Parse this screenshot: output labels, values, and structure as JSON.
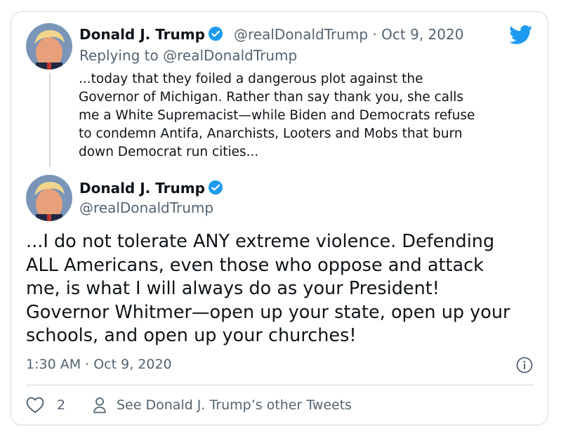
{
  "quoted_tweet": {
    "author_name": "Donald J. Trump",
    "handle": "@realDonaldTrump",
    "separator": "·",
    "date": "Oct 9, 2020",
    "replying_to": "Replying to @realDonaldTrump",
    "text": "...today that they foiled a dangerous plot against the\nGovernor of Michigan. Rather than say thank you, she calls\nme a White Supremacist—while Biden and Democrats refuse\nto condemn Antifa, Anarchists, Looters and Mobs that burn\ndown Democrat run cities..."
  },
  "main_tweet": {
    "author_name": "Donald J. Trump",
    "handle": "@realDonaldTrump",
    "text": "...I do not tolerate ANY extreme violence. Defending\nALL Americans, even those who oppose and attack\nme, is what I will always do as your President!\nGovernor Whitmer—open up your state, open up your\nschools, and open up your churches!",
    "timestamp": "1:30 AM · Oct 9, 2020"
  },
  "footer": {
    "like_count": "2",
    "see_other": "See Donald J. Trump’s other Tweets"
  },
  "icons": {
    "logo": "twitter-bird-icon",
    "verified": "verified-badge-icon",
    "info": "info-icon",
    "like": "heart-icon",
    "profile": "person-icon"
  },
  "colors": {
    "twitter_blue": "#1d9bf0",
    "secondary_text": "#536471",
    "border": "#cfd9de"
  }
}
